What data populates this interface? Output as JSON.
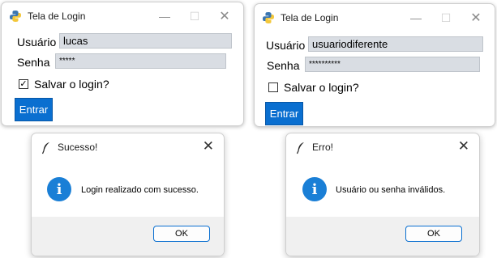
{
  "left_window": {
    "title": "Tela de Login",
    "usuario_label": "Usuário",
    "usuario_value": "lucas",
    "senha_label": "Senha",
    "senha_value": "*****",
    "save_label": "Salvar o login?",
    "save_checked": true,
    "save_mark": "✓",
    "enter_label": "Entrar"
  },
  "right_window": {
    "title": "Tela de Login",
    "usuario_label": "Usuário",
    "usuario_value": "usuariodiferente",
    "senha_label": "Senha",
    "senha_value": "**********",
    "save_label": "Salvar o login?",
    "save_checked": false,
    "save_mark": "",
    "enter_label": "Entrar"
  },
  "success_dialog": {
    "title": "Sucesso!",
    "message": "Login realizado com sucesso.",
    "ok_label": "OK",
    "info_glyph": "i"
  },
  "error_dialog": {
    "title": "Erro!",
    "message": "Usuário ou senha inválidos.",
    "ok_label": "OK",
    "info_glyph": "i"
  },
  "titlebar": {
    "minimize_glyph": "—",
    "maximize_glyph": "☐",
    "close_glyph": "✕"
  },
  "colors": {
    "accent": "#0a6fd0",
    "field_bg": "#d9dde3",
    "info_blue": "#1a7fd6"
  }
}
